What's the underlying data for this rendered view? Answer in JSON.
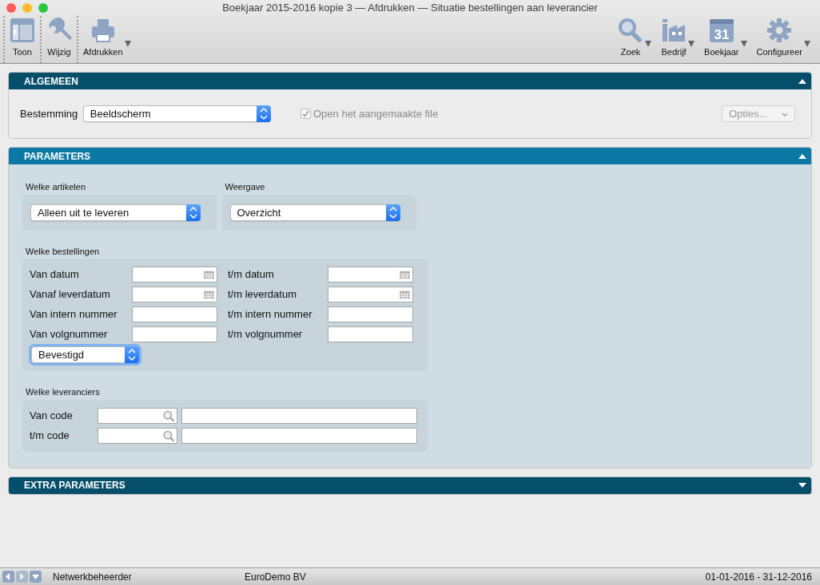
{
  "window": {
    "title": "Boekjaar 2015-2016 kopie 3 — Afdrukken — Situatie bestellingen aan leverancier"
  },
  "toolbar": {
    "left": [
      {
        "label": "Toon",
        "has_menu": false
      },
      {
        "label": "Wijzig",
        "has_menu": false
      },
      {
        "label": "Afdrukken",
        "has_menu": true
      }
    ],
    "right": [
      {
        "label": "Zoek",
        "has_menu": true
      },
      {
        "label": "Bedrijf",
        "has_menu": true
      },
      {
        "label": "Boekjaar",
        "icon_text": "31",
        "has_menu": true
      },
      {
        "label": "Configureer",
        "has_menu": true
      }
    ]
  },
  "algemeen": {
    "title": "ALGEMEEN",
    "expanded": true,
    "highlighted": false,
    "destination": {
      "label": "Bestemming",
      "value": "Beeldscherm"
    },
    "open_file": {
      "label": "Open het aangemaakte file",
      "checked": true,
      "disabled": true
    },
    "options_button": {
      "label": "Opties...",
      "disabled": true
    }
  },
  "parameters": {
    "title": "PARAMETERS",
    "expanded": true,
    "highlighted": true,
    "articles": {
      "label": "Welke artikelen",
      "value": "Alleen uit te leveren",
      "focused": false
    },
    "view": {
      "label": "Weergave",
      "value": "Overzicht",
      "focused": false
    },
    "orders": {
      "label": "Welke bestellingen",
      "fields": [
        {
          "label": "Van datum",
          "kind": "date"
        },
        {
          "label": "t/m datum",
          "kind": "date"
        },
        {
          "label": "Vanaf leverdatum",
          "kind": "date"
        },
        {
          "label": "t/m leverdatum",
          "kind": "date"
        },
        {
          "label": "Van intern nummer",
          "kind": "text"
        },
        {
          "label": "t/m intern nummer",
          "kind": "text"
        },
        {
          "label": "Van volgnummer",
          "kind": "text"
        },
        {
          "label": "t/m volgnummer",
          "kind": "text"
        }
      ],
      "status": {
        "value": "Bevestigd",
        "focused": true
      }
    },
    "suppliers": {
      "label": "Welke leveranciers",
      "rows": [
        {
          "label": "Van code"
        },
        {
          "label": "t/m code"
        }
      ]
    }
  },
  "extra_parameters": {
    "title": "EXTRA PARAMETERS",
    "expanded": false,
    "highlighted": false
  },
  "status_bar": {
    "user": "Netwerkbeheerder",
    "company": "EuroDemo BV",
    "period": "01-01-2016 - 31-12-2016"
  }
}
